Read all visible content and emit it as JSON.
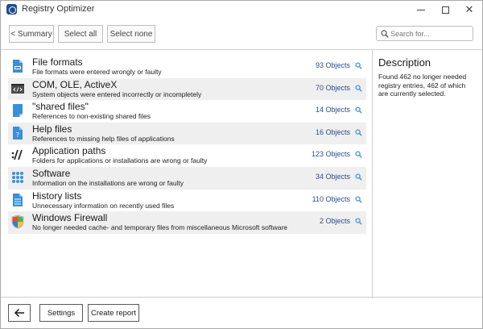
{
  "window": {
    "title": "Registry Optimizer"
  },
  "toolbar": {
    "summary_label": "< Summary",
    "select_all_label": "Select all",
    "select_none_label": "Select none",
    "search_placeholder": "Search for...",
    "search_value": ""
  },
  "items": [
    {
      "title": "File formats",
      "description": "File formats were entered wrongly or faulty",
      "count": "93 Objects",
      "icon": "file-format-icon"
    },
    {
      "title": "COM, OLE, ActiveX",
      "description": "System objects were entered incorrectly or incompletely",
      "count": "70 Objects",
      "icon": "code-window-icon"
    },
    {
      "title": "\"shared files\"",
      "description": "References to non-existing shared files",
      "count": "14 Objects",
      "icon": "shared-file-icon"
    },
    {
      "title": "Help files",
      "description": "References to missing help files of applications",
      "count": "16 Objects",
      "icon": "help-file-icon"
    },
    {
      "title": "Application paths",
      "description": "Folders for applications or installations are wrong or faulty",
      "count": "123 Objects",
      "icon": "path-slashes-icon"
    },
    {
      "title": "Software",
      "description": "Information on the installations are wrong or faulty",
      "count": "34 Objects",
      "icon": "app-grid-icon"
    },
    {
      "title": "History lists",
      "description": "Unnecessary information on recently used files",
      "count": "110 Objects",
      "icon": "history-list-icon"
    },
    {
      "title": "Windows Firewall",
      "description": "No longer needed cache- and temporary files from miscellaneous Microsoft software",
      "count": "2 Objects",
      "icon": "firewall-shield-icon"
    }
  ],
  "description_panel": {
    "title": "Description",
    "text": "Found 462 no longer needed registry entries, 462 of which are currently selected."
  },
  "bottombar": {
    "settings_label": "Settings",
    "create_report_label": "Create report"
  },
  "colors": {
    "accent": "#2b4c8c",
    "icon_blue": "#3a8fd9",
    "row_alt": "#efefef"
  }
}
